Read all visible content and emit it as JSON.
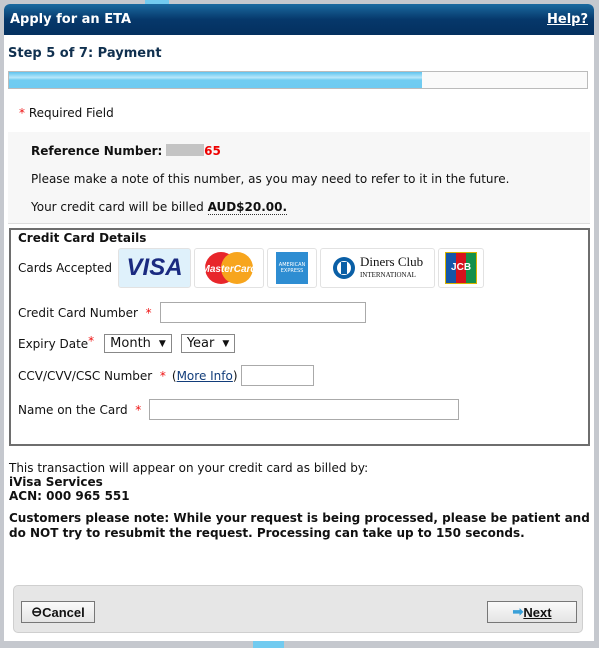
{
  "header": {
    "title": "Apply for an ETA",
    "help": "Help?"
  },
  "step": {
    "label": "Step 5 of 7: Payment",
    "progress": 0.714
  },
  "required": {
    "star": "*",
    "label": "Required Field"
  },
  "reference": {
    "label": "Reference Number:",
    "suffix": "65",
    "note": "Please make a note of this number, as you may need to refer to it in the future.",
    "billed_prefix": "Your credit card will be billed",
    "amount": "AUD$20.00."
  },
  "cc": {
    "title": "Credit Card Details",
    "cards_label": "Cards Accepted",
    "cards": [
      "VISA",
      "MasterCard",
      "American Express",
      "Diners Club International",
      "JCB"
    ],
    "number_label": "Credit Card Number",
    "expiry_label": "Expiry Date",
    "month": "Month",
    "year": "Year",
    "ccv_label": "CCV/CVV/CSC Number",
    "more_info": "More Info",
    "name_label": "Name on the Card",
    "star": "*"
  },
  "billing": {
    "line": "This transaction will appear on your credit card as billed by:",
    "company": "iVisa Services",
    "acn": "ACN: 000 965 551"
  },
  "warning": "Customers please note: While your request is being processed, please be patient and do NOT try to resubmit the request. Processing can take up to 150 seconds.",
  "buttons": {
    "cancel": "Cancel",
    "next": "Next"
  }
}
